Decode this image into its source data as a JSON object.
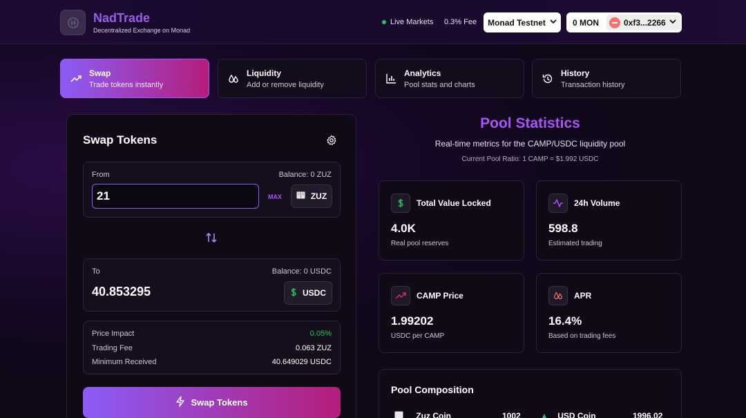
{
  "header": {
    "brand_title": "NadTrade",
    "brand_subtitle": "Decentralized Exchange on Monad",
    "live_markets": "Live Markets",
    "fee": "0.3% Fee",
    "network": "Monad Testnet",
    "wallet_balance": "0 MON",
    "wallet_address": "0xf3...2266"
  },
  "tabs": [
    {
      "label": "Swap",
      "sub": "Trade tokens instantly",
      "icon": "trending-up-icon"
    },
    {
      "label": "Liquidity",
      "sub": "Add or remove liquidity",
      "icon": "droplets-icon"
    },
    {
      "label": "Analytics",
      "sub": "Pool stats and charts",
      "icon": "bar-chart-icon"
    },
    {
      "label": "History",
      "sub": "Transaction history",
      "icon": "history-icon"
    }
  ],
  "swap": {
    "title": "Swap Tokens",
    "from": {
      "label": "From",
      "balance": "Balance: 0 ZUZ",
      "amount": "21",
      "max": "MAX",
      "token": "ZUZ"
    },
    "to": {
      "label": "To",
      "balance": "Balance: 0 USDC",
      "amount": "40.853295",
      "token": "USDC"
    },
    "info": [
      {
        "label": "Price Impact",
        "value": "0.05%"
      },
      {
        "label": "Trading Fee",
        "value": "0.063 ZUZ"
      },
      {
        "label": "Minimum Received",
        "value": "40.649029 USDC"
      }
    ],
    "button": "Swap Tokens"
  },
  "pool": {
    "title": "Pool Statistics",
    "subtitle": "Real-time metrics for the CAMP/USDC liquidity pool",
    "ratio": "Current Pool Ratio: 1 CAMP = $1.992 USDC",
    "stats": [
      {
        "label": "Total Value Locked",
        "value": "4.0K",
        "desc": "Real pool reserves",
        "icon": "dollar-icon"
      },
      {
        "label": "24h Volume",
        "value": "598.8",
        "desc": "Estimated trading",
        "icon": "activity-icon"
      },
      {
        "label": "CAMP Price",
        "value": "1.99202",
        "desc": "USDC per CAMP",
        "icon": "trending-up-icon"
      },
      {
        "label": "APR",
        "value": "16.4%",
        "desc": "Based on trading fees",
        "icon": "droplets-icon"
      }
    ],
    "composition": {
      "title": "Pool Composition",
      "items": [
        {
          "name": "Zuz Coin",
          "value": "1002"
        },
        {
          "name": "USD Coin",
          "value": "1996.02"
        }
      ]
    }
  },
  "colors": {
    "accent": "#8b5cf6",
    "accent2": "#b51d7b",
    "positive": "#22c55e",
    "brand": "#9b5de5"
  }
}
